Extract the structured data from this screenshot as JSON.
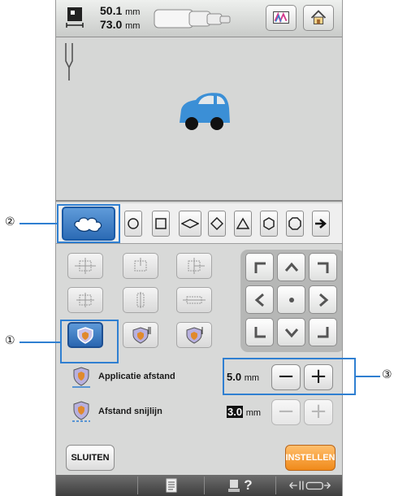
{
  "top_bar": {
    "width_value": "50.1",
    "height_value": "73.0",
    "unit": "mm",
    "icons": [
      "embroidery-size-icon",
      "thread-spool-icon",
      "color-palette-icon",
      "home-icon"
    ]
  },
  "preview": {
    "design": "car-embroidery",
    "design_colors": [
      "#3b8fd6",
      "#111111"
    ]
  },
  "outline_shapes": [
    "cloud-outline",
    "circle",
    "square",
    "flat-diamond",
    "diamond",
    "triangle",
    "hexagon",
    "octagon",
    "next-arrow"
  ],
  "settings": {
    "applique_distance": {
      "label": "Applicatie afstand",
      "value": "5.0",
      "unit": "mm"
    },
    "cut_distance": {
      "label": "Afstand snijlijn",
      "value": "3.0",
      "unit": "mm"
    }
  },
  "buttons": {
    "close": "SLUITEN",
    "set": "INSTELLEN"
  },
  "callouts": {
    "one": "①",
    "two": "②",
    "three": "③"
  },
  "bottom_bar": {
    "question_mark": "?"
  },
  "colors": {
    "accent_blue": "#2c6bb5",
    "orange": "#f08a1a",
    "callout": "#2f7fd1"
  }
}
